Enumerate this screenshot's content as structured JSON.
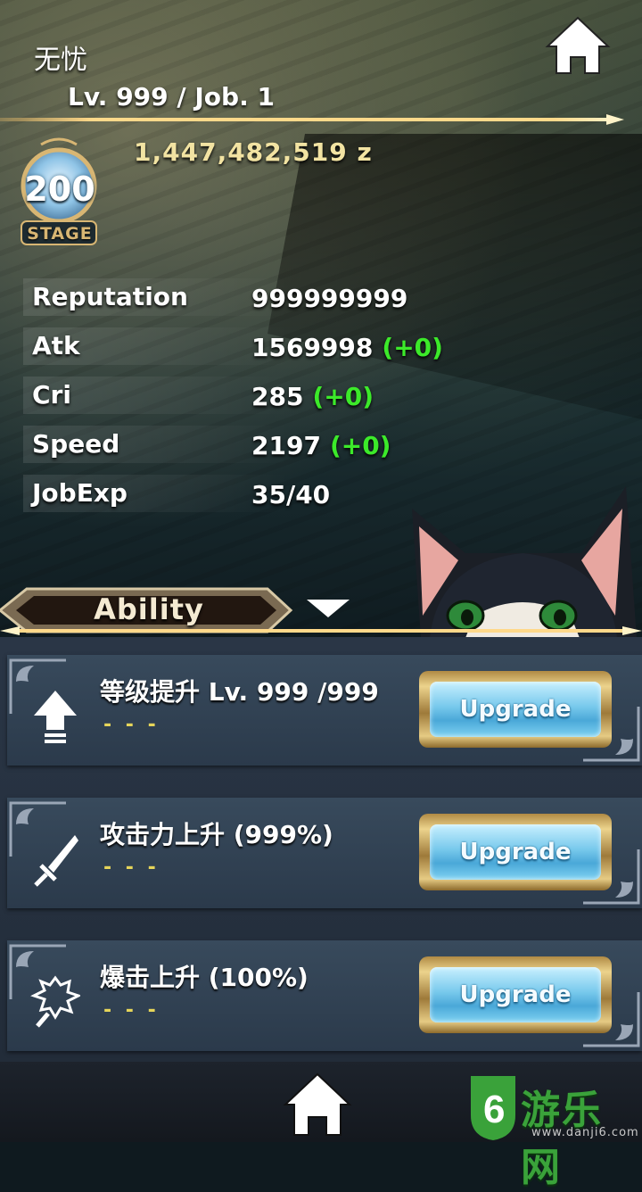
{
  "player": {
    "name": "无忧",
    "level_line": "Lv. 999 / Job. 1",
    "zeny": "1,447,482,519 z"
  },
  "stage": {
    "number": "200",
    "label": "STAGE"
  },
  "stats": [
    {
      "label": "Reputation",
      "value": "999999999",
      "bonus": ""
    },
    {
      "label": "Atk",
      "value": "1569998",
      "bonus": "(+0)"
    },
    {
      "label": "Cri",
      "value": "285",
      "bonus": "(+0)"
    },
    {
      "label": "Speed",
      "value": "2197",
      "bonus": "(+0)"
    },
    {
      "label": "JobExp",
      "value": "35/40",
      "bonus": ""
    }
  ],
  "ability_tab": {
    "label": "Ability"
  },
  "abilities": [
    {
      "title": "等级提升 Lv. 999 /999",
      "sub": "- - -",
      "button": "Upgrade",
      "icon": "arrow-up-icon"
    },
    {
      "title": "攻击力上升 (999%)",
      "sub": "- - -",
      "button": "Upgrade",
      "icon": "sword-icon"
    },
    {
      "title": "爆击上升 (100%)",
      "sub": "- - -",
      "button": "Upgrade",
      "icon": "crit-blade-icon"
    }
  ],
  "watermark": {
    "text": "游乐网",
    "url": "www.danji6.com"
  },
  "colors": {
    "bonus_green": "#3cea2a",
    "gold": "#d8b673",
    "button_blue": "#78c9ec"
  }
}
